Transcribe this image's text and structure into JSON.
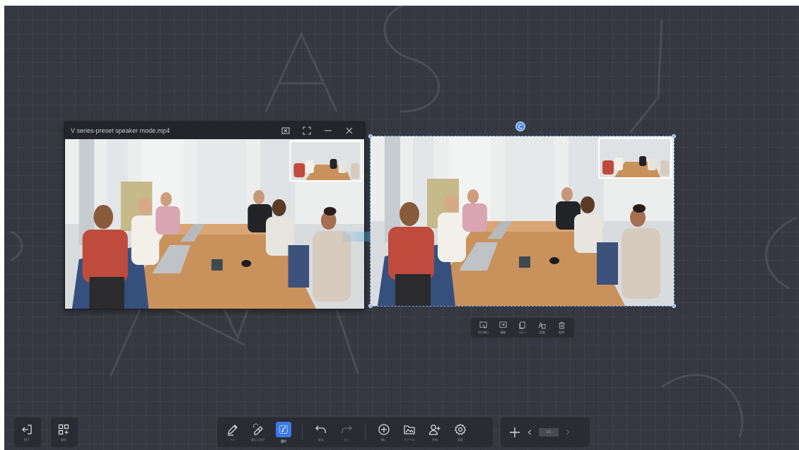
{
  "video_window": {
    "title": "V series-preset speaker mode.mp4",
    "controls": [
      "snapshot-icon",
      "fullscreen-icon",
      "minimize-icon",
      "close-icon"
    ]
  },
  "selection_menu": {
    "items": [
      {
        "icon": "cut-icon",
        "label": "切り取り"
      },
      {
        "icon": "move-icon",
        "label": "移動"
      },
      {
        "icon": "copy-icon",
        "label": "コピー"
      },
      {
        "icon": "text-recognize-icon",
        "label": "認識"
      },
      {
        "icon": "delete-icon",
        "label": "削除"
      }
    ]
  },
  "toolbar_left": {
    "exit_label": "終了",
    "save_label": "保存"
  },
  "toolbar_main": {
    "pen_label": "ペン",
    "lasso_label": "囲んで消す",
    "select_label": "選択",
    "undo_label": "戻る",
    "redo_label": "進む",
    "insert_label": "挿入",
    "file_label": "ファイル",
    "share_label": "共有",
    "settings_label": "設定"
  },
  "toolbar_pages": {
    "page_indicator": "1/1"
  },
  "watermark": {
    "text": "M A X   S Y S"
  },
  "colors": {
    "board_background": "#353841",
    "accent": "#3b7ae6",
    "arrow": "#4fb3e8"
  }
}
